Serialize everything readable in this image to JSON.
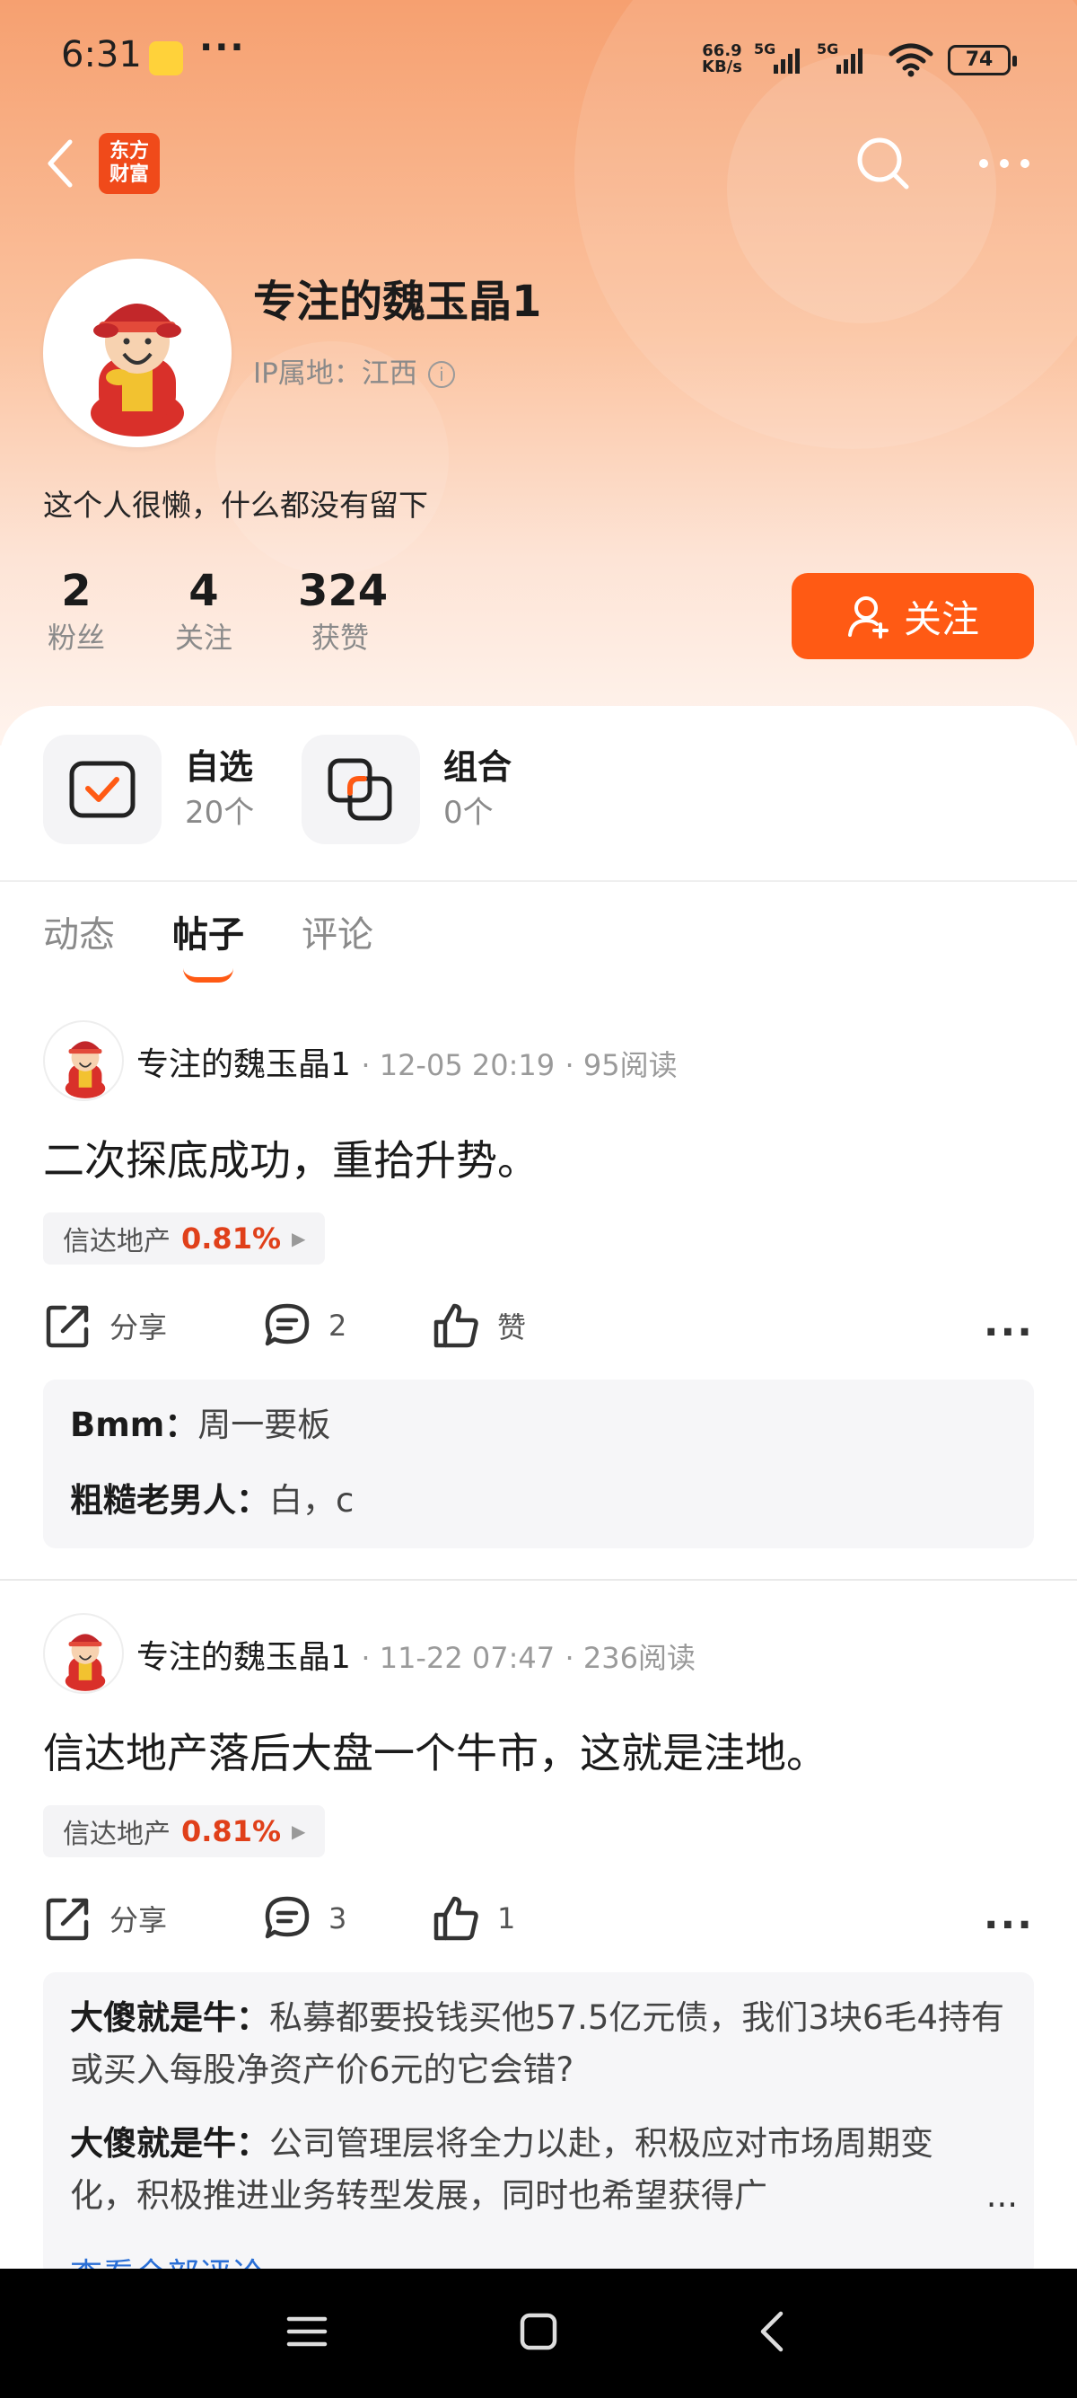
{
  "status_bar": {
    "time": "6:31",
    "more": "···",
    "speed_top": "66.9",
    "speed_unit": "KB/s",
    "net1": "5G",
    "net2": "5G",
    "battery": "74"
  },
  "nav": {
    "logo_text_line1": "东方",
    "logo_text_line2": "财富",
    "icons": [
      "back-icon",
      "search-icon",
      "more-icon"
    ]
  },
  "profile": {
    "username": "专注的魏玉晶1",
    "ip_label": "IP属地：江西",
    "bio": "这个人很懒，什么都没有留下",
    "stats": [
      {
        "num": "2",
        "label": "粉丝"
      },
      {
        "num": "4",
        "label": "关注"
      },
      {
        "num": "324",
        "label": "获赞"
      }
    ],
    "follow_label": "关注"
  },
  "quick_cards": [
    {
      "title": "自选",
      "sub": "20个"
    },
    {
      "title": "组合",
      "sub": "0个"
    }
  ],
  "tabs": [
    {
      "label": "动态",
      "active": false
    },
    {
      "label": "帖子",
      "active": true
    },
    {
      "label": "评论",
      "active": false
    }
  ],
  "posts": [
    {
      "author": "专注的魏玉晶1",
      "time": "12-05 20:19",
      "reads": "95阅读",
      "title": "二次探底成功，重拾升势。",
      "stock_name": "信达地产",
      "stock_pct": "0.81%",
      "share": "分享",
      "comment_count": "2",
      "like": "赞",
      "comments": [
        {
          "user": "Bmm：",
          "text": "周一要板"
        },
        {
          "user": "粗糙老男人：",
          "text": "白，c"
        }
      ]
    },
    {
      "author": "专注的魏玉晶1",
      "time": "11-22 07:47",
      "reads": "236阅读",
      "title": "信达地产落后大盘一个牛市，这就是洼地。",
      "stock_name": "信达地产",
      "stock_pct": "0.81%",
      "share": "分享",
      "comment_count": "3",
      "like": "1",
      "comments": [
        {
          "user": "大傻就是牛：",
          "text": "私募都要投钱买他57.5亿元债，我们3块6毛4持有或买入每股净资产价6元的它会错?"
        },
        {
          "user": "大傻就是牛：",
          "text": "公司管理层将全力以赴，积极应对市场周期变化，积极推进业务转型发展，同时也希望获得广"
        }
      ],
      "more_text": "...",
      "see_all": "查看全部评论 ›"
    }
  ],
  "colors": {
    "accent": "#ff5a14",
    "stock_up": "#e0401a"
  }
}
